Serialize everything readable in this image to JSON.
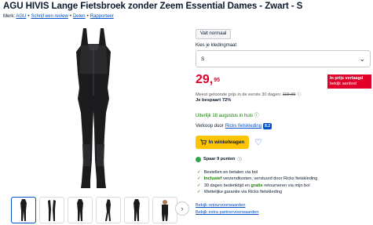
{
  "product": {
    "title": "AGU HIVIS Lange Fietsbroek zonder Zeem Essential Dames - Zwart - S",
    "brand_prefix": "Merk: ",
    "brand": "AGU",
    "write_review": "Schrijf een review",
    "share": "Delen",
    "report": "Rapporteer"
  },
  "variant": {
    "color_chip": "Valt normaal",
    "size_label": "Kies je kledingmaat",
    "size_value": "S"
  },
  "pricing": {
    "price_main": "29,",
    "price_cents": "95",
    "deal_line1": "In prijs verlaagd",
    "deal_line2": "bekijk aanbod",
    "lowest_text": "Meest getoonde prijs in de eerste 30 dagen: ",
    "lowest_old": "119,99",
    "saving": "Je bespaart 72%"
  },
  "delivery": {
    "text": "Uiterlijk 18 augustus in huis"
  },
  "seller": {
    "prefix": "Verkoop door ",
    "name": "Ricks fietskleding",
    "score": "8.2"
  },
  "cart": {
    "button_label": "In winkelwagen"
  },
  "points": {
    "label": "Spaar 9 punten"
  },
  "usps": [
    {
      "pre": "Bestellen en betalen via bol",
      "bold": "",
      "post": ""
    },
    {
      "pre": "",
      "bold": "Inclusief",
      "post": " verzendkosten, verstuurd door Ricks fietskleding"
    },
    {
      "pre": "30 dagen bedenktijd en ",
      "bold": "gratis",
      "post": " retourneren via mijn bol"
    },
    {
      "pre": "Wettelijke garantie via Ricks fietskleding",
      "bold": "",
      "post": ""
    }
  ],
  "links": {
    "returns": "Bekijk retourvoorwaarden",
    "partner": "Bekijk extra partnervoorwaarden"
  },
  "colors": {
    "price_red": "#e0002a",
    "link_blue": "#0050c8",
    "cta_yellow": "#ffc400",
    "green": "#147a00"
  }
}
